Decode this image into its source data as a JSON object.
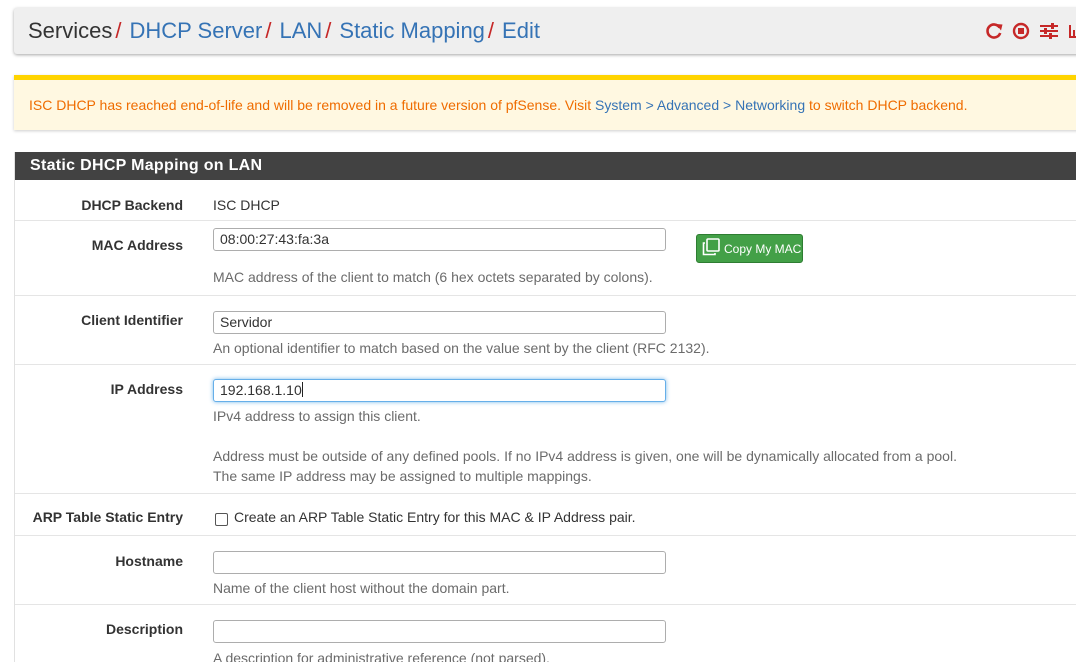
{
  "breadcrumb": {
    "items": [
      {
        "label": "Services",
        "link": false
      },
      {
        "label": "DHCP Server",
        "link": true
      },
      {
        "label": "LAN",
        "link": true
      },
      {
        "label": "Static Mapping",
        "link": true
      },
      {
        "label": "Edit",
        "link": true
      }
    ],
    "separator": "/",
    "icons": [
      "refresh-icon",
      "stop-icon",
      "sliders-icon",
      "bar-chart-icon"
    ]
  },
  "alert": {
    "text_before": "ISC DHCP has reached end-of-life and will be removed in a future version of pfSense. Visit ",
    "link": "System > Advanced > Networking",
    "text_after": " to switch DHCP backend."
  },
  "panel": {
    "title": "Static DHCP Mapping on LAN",
    "dhcp_backend": {
      "label": "DHCP Backend",
      "value": "ISC DHCP"
    },
    "mac_address": {
      "label": "MAC Address",
      "value": "08:00:27:43:fa:3a",
      "button": "Copy My MAC",
      "help": "MAC address of the client to match (6 hex octets separated by colons)."
    },
    "client_identifier": {
      "label": "Client Identifier",
      "value": "Servidor",
      "help": "An optional identifier to match based on the value sent by the client (RFC 2132)."
    },
    "ip_address": {
      "label": "IP Address",
      "value": "192.168.1.10",
      "help1": "IPv4 address to assign this client.",
      "help2": "Address must be outside of any defined pools. If no IPv4 address is given, one will be dynamically allocated from a pool.",
      "help3": "The same IP address may be assigned to multiple mappings."
    },
    "arp": {
      "label": "ARP Table Static Entry",
      "checkbox_label": "Create an ARP Table Static Entry for this MAC & IP Address pair.",
      "checked": false
    },
    "hostname": {
      "label": "Hostname",
      "value": "",
      "help": "Name of the client host without the domain part."
    },
    "description": {
      "label": "Description",
      "value": "",
      "help": "A description for administrative reference (not parsed)."
    }
  },
  "colors": {
    "link": "#3573b5",
    "separator": "#c62828",
    "alert_text": "#ef6c00",
    "alert_bg": "#fff8e1",
    "panel_heading": "#424242",
    "button_green": "#43a047",
    "icon_red": "#c62828"
  }
}
